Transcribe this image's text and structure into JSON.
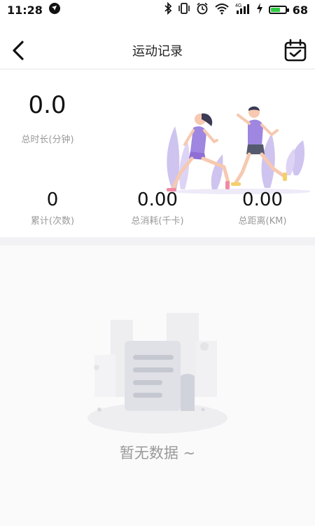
{
  "status_bar": {
    "time": "11:28",
    "battery": "68",
    "battery_level": 0.68,
    "icons": [
      "app-notification-icon",
      "bluetooth-icon",
      "vibrate-icon",
      "alarm-icon",
      "wifi-icon",
      "signal-icon",
      "charging-icon",
      "battery-icon"
    ],
    "network_label": "4G"
  },
  "header": {
    "title": "运动记录",
    "back_icon": "back-arrow-icon",
    "right_icon": "calendar-check-icon"
  },
  "summary": {
    "total_time": {
      "value": "0.0",
      "label": "总时长(分钟)"
    },
    "count": {
      "value": "0",
      "label": "累计(次数)"
    },
    "calories": {
      "value": "0.00",
      "label": "总消耗(千卡)"
    },
    "distance": {
      "value": "0.00",
      "label": "总距离(KM)"
    }
  },
  "empty_state": {
    "text": "暂无数据 ~"
  },
  "colors": {
    "accent_purple": "#8f6ed5",
    "illustration_lavender": "#cfc4f0",
    "battery_green": "#2ecc40",
    "muted_text": "#9a9a9a"
  }
}
